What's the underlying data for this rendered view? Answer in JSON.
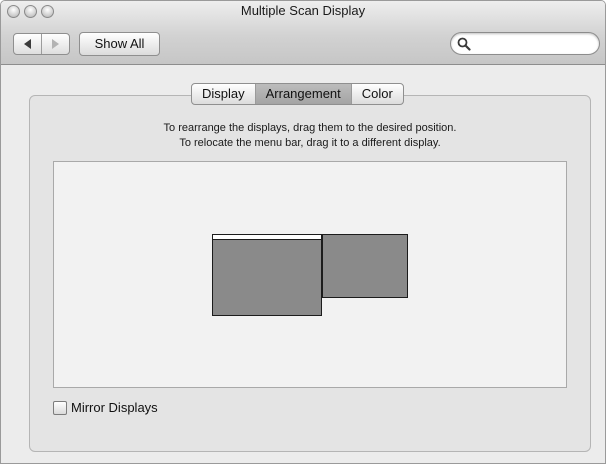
{
  "window": {
    "title": "Multiple Scan Display"
  },
  "toolbar": {
    "back_icon": "back-arrow-icon",
    "forward_icon": "forward-arrow-icon",
    "show_all_label": "Show All",
    "search_value": "",
    "search_icon": "magnifier-icon"
  },
  "tabs": [
    {
      "label": "Display",
      "selected": false
    },
    {
      "label": "Arrangement",
      "selected": true
    },
    {
      "label": "Color",
      "selected": false
    }
  ],
  "arrangement": {
    "instruction_line1": "To rearrange the displays, drag them to the desired position.",
    "instruction_line2": "To relocate the menu bar, drag it to a different display.",
    "displays": [
      {
        "name": "main display",
        "has_menu_bar": true
      },
      {
        "name": "secondary display",
        "has_menu_bar": false
      }
    ]
  },
  "mirror": {
    "label": "Mirror Displays",
    "checked": false
  },
  "colors": {
    "window_bg": "#ececec",
    "display_fill": "#8a8a8a",
    "arrangement_bg": "#f2f2f2"
  }
}
